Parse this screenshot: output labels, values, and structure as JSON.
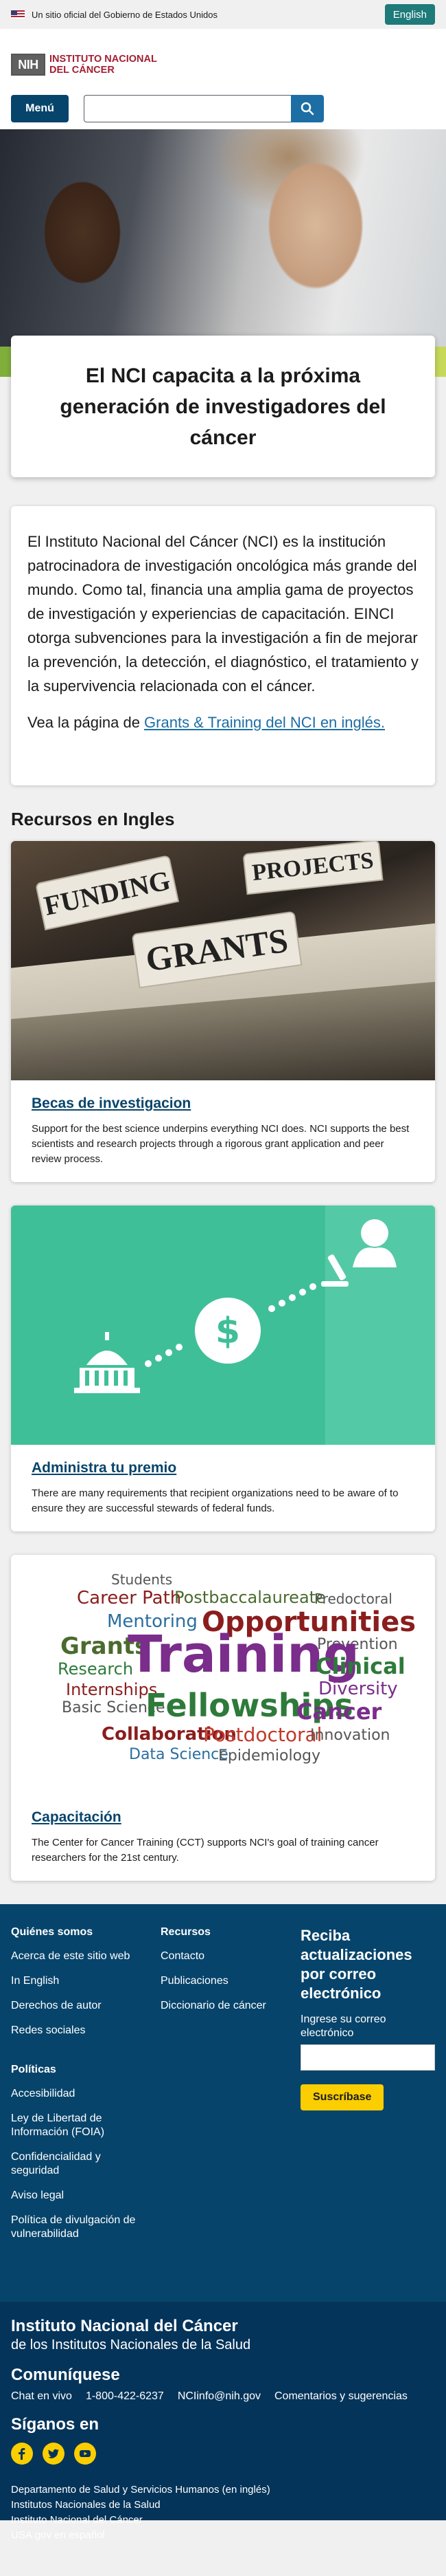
{
  "gov_banner": {
    "text": "Un sitio oficial del Gobierno de Estados Unidos",
    "lang_button": "English"
  },
  "header": {
    "logo_line1": "Instituto Nacional",
    "logo_line2": "del Cáncer",
    "logo_badge": "NIH",
    "menu_label": "Menú",
    "search_placeholder": ""
  },
  "hero": {
    "title": "El NCI capacita a la próxima generación de investigadores del cáncer"
  },
  "intro": {
    "text": "El Instituto Nacional del Cáncer (NCI) es la institución patrocinadora de investigación oncológica más grande del mundo. Como tal, financia una amplia gama de proyectos de investigación y experiencias de capacitación. EINCI otorga subvenciones para la investigación a fin de mejorar la prevención, la detección, el diagnóstico, el tratamiento y la supervivencia relacionada con el cáncer.",
    "link_prefix": "Vea la página de ",
    "link_text": "Grants & Training del NCI en inglés."
  },
  "resources": {
    "section_title": "Recursos en Ingles",
    "cards": [
      {
        "title": "Becas de investigacion",
        "desc": "Support for the best science underpins everything NCI does. NCI supports the best scientists and research projects through a rigorous grant application and peer review process.",
        "image_tabs": [
          "FUNDING",
          "PROJECTS",
          "GRANTS"
        ]
      },
      {
        "title": "Administra tu premio",
        "desc": "There are many requirements that recipient organizations need to be aware of to ensure they are successful stewards of federal funds.",
        "image_symbol": "$"
      },
      {
        "title": "Capacitación",
        "desc": "The Center for Cancer Training (CCT) supports NCI's goal of training cancer researchers for the 21st century.",
        "cloud_words": [
          "Students",
          "Career Path",
          "Postbaccalaureate",
          "Predoctoral",
          "Mentoring",
          "Opportunities",
          "Grants",
          "Prevention",
          "Research",
          "Training",
          "Clinical",
          "Internships",
          "Diversity",
          "Basic Science",
          "Fellowships",
          "Cancer",
          "Collaboration",
          "Postdoctoral",
          "Innovation",
          "Data Science",
          "Epidemiology"
        ]
      }
    ]
  },
  "footer": {
    "col1": {
      "heading": "Quiénes somos",
      "links": [
        "Acerca de este sitio web",
        "In English",
        "Derechos de autor",
        "Redes sociales"
      ]
    },
    "col1b": {
      "heading": "Políticas",
      "links": [
        "Accesibilidad",
        "Ley de Libertad de Información (FOIA)",
        "Confidencialidad y seguridad",
        "Aviso legal",
        "Política de divulgación de vulnerabilidad"
      ]
    },
    "col2": {
      "heading": "Recursos",
      "links": [
        "Contacto",
        "Publicaciones",
        "Diccionario de cáncer"
      ]
    },
    "newsletter": {
      "title": "Reciba actualizaciones por correo electrónico",
      "label": "Ingrese su correo electrónico",
      "button": "Suscríbase"
    },
    "org_title": "Instituto Nacional del Cáncer",
    "org_sub": "de los Institutos Nacionales de la Salud",
    "contact_heading": "Comuníquese",
    "contacts": [
      "Chat en vivo",
      "1-800-422-6237",
      "NCIinfo@nih.gov",
      "Comentarios y sugerencias"
    ],
    "social_heading": "Síganos en",
    "social_icons": [
      "facebook-icon",
      "twitter-icon",
      "youtube-icon"
    ],
    "bottom_links": [
      "Departamento de Salud y Servicios Humanos (en inglés)",
      "Institutos Nacionales de la Salud",
      "Instituto Nacional del Cáncer",
      "USA.gov en español"
    ]
  },
  "colors": {
    "primary": "#07446b",
    "accent_red": "#a31f34",
    "link": "#1c6ea4",
    "footer_dark": "#05345a",
    "button_yellow": "#face00"
  }
}
